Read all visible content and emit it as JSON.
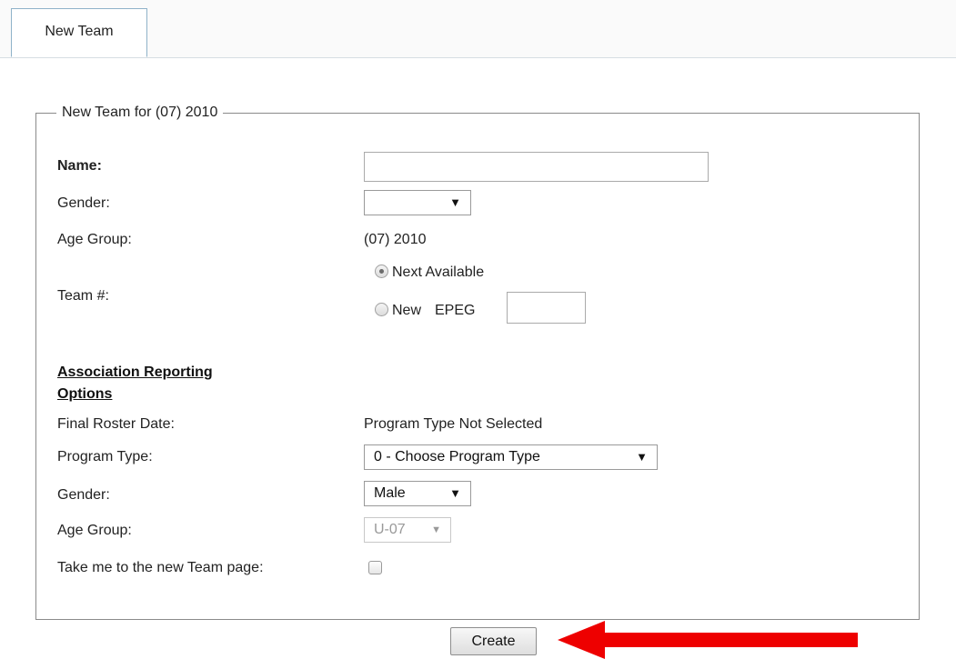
{
  "tabs": [
    {
      "label": "New Team"
    }
  ],
  "form": {
    "legend": "New Team for (07) 2010",
    "name_label": "Name:",
    "name_value": "",
    "gender_label": "Gender:",
    "gender_value": "",
    "age_group_label": "Age Group:",
    "age_group_value": "(07) 2010",
    "team_number_label": "Team #:",
    "team_number_options": {
      "next_available": "Next Available",
      "new": "New",
      "new_prefix": "EPEG",
      "selected": "next_available"
    },
    "team_number_value": ""
  },
  "association": {
    "heading_line1": "Association Reporting",
    "heading_line2": "Options",
    "final_roster_label": "Final Roster Date:",
    "final_roster_value": "Program Type Not Selected",
    "program_type_label": "Program Type:",
    "program_type_value": "0 - Choose Program Type",
    "gender_label": "Gender:",
    "gender_value": "Male",
    "age_group_label": "Age Group:",
    "age_group_value": "U-07",
    "take_me_label": "Take me to the new Team page:",
    "take_me_checked": false
  },
  "actions": {
    "create_label": "Create"
  },
  "colors": {
    "arrow": "#ee0000",
    "tab_border": "#8fb2c9"
  },
  "icons": {
    "dropdown": "chevron-down-icon",
    "annotation": "red-arrow-icon"
  }
}
